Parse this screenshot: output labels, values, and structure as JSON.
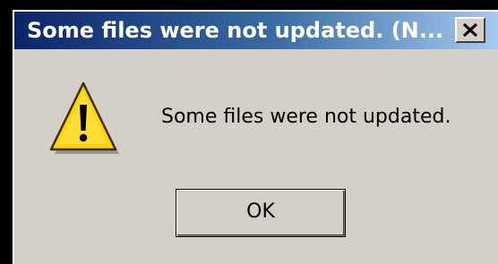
{
  "window": {
    "title": "Some files were not updated. (N...",
    "close_icon": "close-icon"
  },
  "dialog": {
    "icon": "warning-icon",
    "message": "Some files were not updated.",
    "ok_label": "OK"
  },
  "colors": {
    "titlebar_start": "#0a246a",
    "titlebar_end": "#a6caf0",
    "dialog_background": "#d4d0c8",
    "warning_yellow": "#ffd200"
  }
}
